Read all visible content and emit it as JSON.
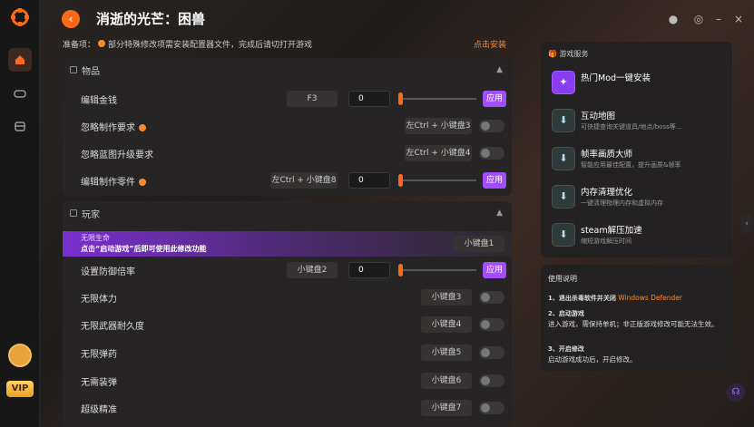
{
  "app": {
    "title": "消逝的光芒：困兽"
  },
  "warning": {
    "prefix": "准备项：",
    "text": "部分特殊修改项需安装配置器文件，完成后请切打开游戏",
    "link": "点击安装"
  },
  "sidebar": {
    "vip": "VIP"
  },
  "items_section": {
    "title": "物品",
    "rows": [
      {
        "label": "编辑金钱",
        "key": "F3",
        "value": "0",
        "apply": "应用"
      },
      {
        "label": "忽略制作要求",
        "key": "左Ctrl + 小键盘3"
      },
      {
        "label": "忽略蓝图升级要求",
        "key": "左Ctrl + 小键盘4"
      },
      {
        "label": "编辑制作零件",
        "key": "左Ctrl + 小键盘8",
        "value": "0",
        "apply": "应用"
      }
    ]
  },
  "player_section": {
    "title": "玩家",
    "highlight": {
      "label": "无限生命",
      "notice": "点击“启动游戏”后即可使用此修改功能",
      "key": "小键盘1"
    },
    "rows": [
      {
        "label": "设置防御倍率",
        "key": "小键盘2",
        "value": "0",
        "apply": "应用"
      },
      {
        "label": "无限体力",
        "key": "小键盘3"
      },
      {
        "label": "无限武器耐久度",
        "key": "小键盘4"
      },
      {
        "label": "无限弹药",
        "key": "小键盘5"
      },
      {
        "label": "无需装弹",
        "key": "小键盘6"
      },
      {
        "label": "超级精准",
        "key": "小键盘7"
      }
    ]
  },
  "services": {
    "title": "游戏服务",
    "items": [
      {
        "title": "热门Mod一键安装",
        "sub": ""
      },
      {
        "title": "互动地图",
        "sub": "可快捷查询关键道具/地点/boss等..."
      },
      {
        "title": "帧率画质大师",
        "sub": "智能应用最佳配置，提升画质&帧率"
      },
      {
        "title": "内存清理优化",
        "sub": "一键清理物理内存和虚拟内存"
      },
      {
        "title": "steam解压加速",
        "sub": "缩短游戏解压时间"
      }
    ]
  },
  "help": {
    "title": "使用说明",
    "s1_pre": "1、退出杀毒软件并关闭",
    "s1_hl": "Windows Defender",
    "s2_title": "2、启动游戏",
    "s2_body": "进入游戏，需保持单机；非正版游戏修改可能无法生效。",
    "s3_title": "3、开启修改",
    "s3_body": "启动游戏成功后，开启修改。"
  }
}
